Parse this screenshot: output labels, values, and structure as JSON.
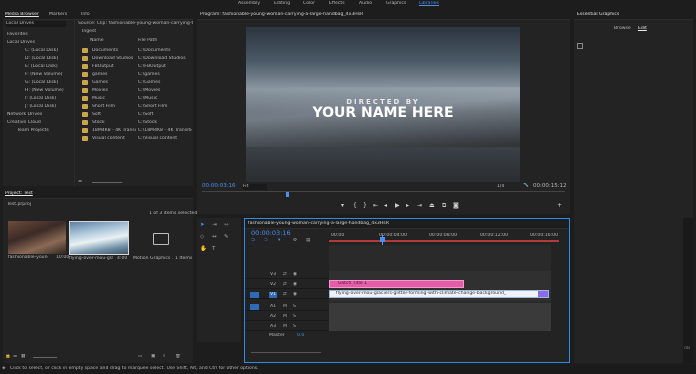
{
  "workspaces": {
    "tabs": [
      "Assembly",
      "Editing",
      "Color",
      "Effects",
      "Audio",
      "Graphics",
      "Libraries"
    ],
    "active": "Libraries"
  },
  "media_browser": {
    "tab1": "Media Browser",
    "tab2": "Markers",
    "tab3": "Info",
    "favorites_label": "Local Drives",
    "tree": [
      "Favorites",
      "Local Drives",
      "C: (Local Disk)",
      "D: (Local Disk)",
      "E: (Local Disk)",
      "F: (New Volume)",
      "G: (Local Disk)",
      "H: (New Volume)",
      "I: (Local Disk)",
      "J: (Local Disk)",
      "Network Drives",
      "Creative Cloud",
      "Team Projects"
    ],
    "path": "Source: Clip: fashionable-young-woman-carrying-t",
    "ingest_label": "Ingest",
    "col_name": "Name",
    "col_path": "File Path",
    "files": [
      {
        "name": "Documents",
        "path": "C:\\Documents"
      },
      {
        "name": "Download Studios",
        "path": "C:\\Download Studios"
      },
      {
        "name": "FBOutput",
        "path": "C:\\FBOutput"
      },
      {
        "name": "games",
        "path": "C:\\games"
      },
      {
        "name": "Games",
        "path": "C:\\Games"
      },
      {
        "name": "Movies",
        "path": "C:\\Movies"
      },
      {
        "name": "Music",
        "path": "C:\\Music"
      },
      {
        "name": "Short Film",
        "path": "C:\\Short Film"
      },
      {
        "name": "Soft",
        "path": "C:\\Soft"
      },
      {
        "name": "Stock",
        "path": "C:\\Stock"
      },
      {
        "name": "18M4K8 - 4K Transiti",
        "path": "C:\\18M4K8 - 4K Transitio"
      },
      {
        "name": "Visual content",
        "path": "C:\\Visual content"
      }
    ]
  },
  "project": {
    "title": "Project: Test",
    "file": "Test.prproj",
    "selected": "1 of 3 items selected",
    "items": [
      {
        "name": "fashionable-young-...",
        "dur": "10:00"
      },
      {
        "name": "flying-over-mou-glac...",
        "dur": "4:00"
      },
      {
        "name": "Motion Graphics ...",
        "dur": "1 Items"
      }
    ]
  },
  "program": {
    "title": "Program: fashionable-young-woman-carrying-a-large-handbag_4x3HsR",
    "directed_by": "DIRECTED BY",
    "name": "YOUR NAME HERE",
    "timecode_in": "00:00:03:16",
    "fit": "Fit",
    "ratio": "1/4",
    "timecode_out": "00:00:15:12"
  },
  "essential_graphics": {
    "title": "Essential Graphics",
    "tab_browse": "Browse",
    "tab_edit": "Edit"
  },
  "timeline": {
    "tab": "fashionable-young-woman-carrying-a-large-handbag_4x3HsR",
    "timecode": "00:00:03:16",
    "ruler": [
      "00:00",
      "00:00:04:00",
      "00:00:08:00",
      "00:00:12:00",
      "00:00:16:00",
      "00:00:20:00"
    ],
    "video_tracks": [
      "V3",
      "V2",
      "V1"
    ],
    "audio_tracks": [
      "A1",
      "A2",
      "A3"
    ],
    "master_label": "Master",
    "master_val": "0.0",
    "clip_title": "Glitch Title 1",
    "clip_video": "flying-over-mou-glaciers-glitter-forming-with-climate-change-background_4x3egn_D.mp4"
  },
  "status": {
    "text": "Click to select, or click in empty space and drag to marquee select. Use Shift, Alt, and Ctrl for other options."
  },
  "colors": {
    "accent": "#2d8ceb",
    "title_clip": "#e65cab",
    "video_clip": "#9bb5e6"
  }
}
